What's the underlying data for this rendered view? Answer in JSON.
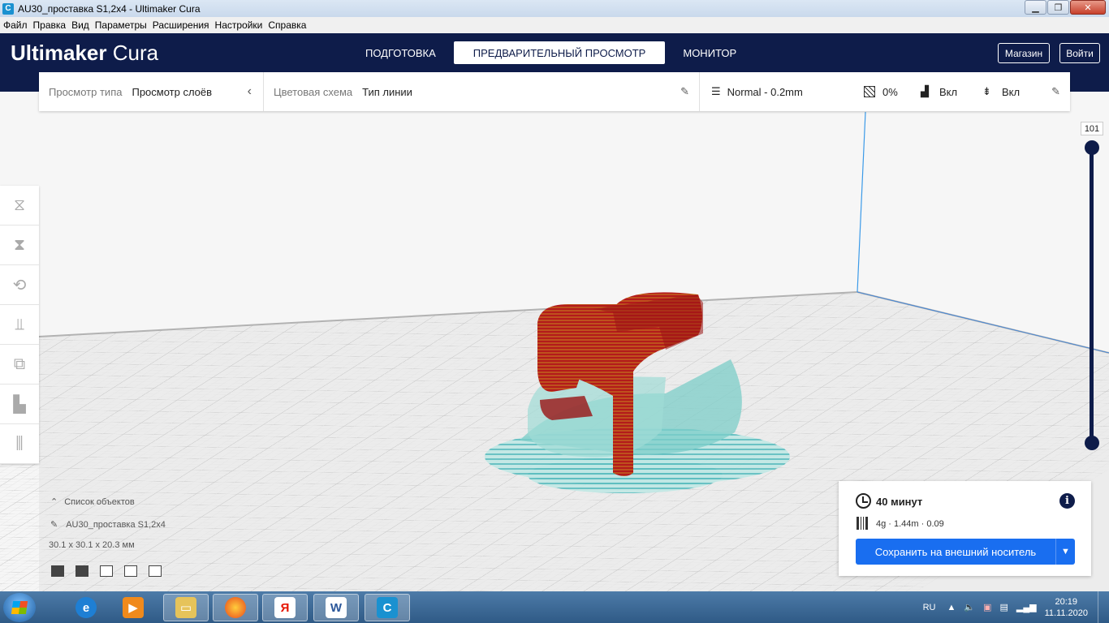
{
  "window": {
    "title": "AU30_проставка S1,2x4 - Ultimaker Cura",
    "app_icon": "cura-icon"
  },
  "menu": [
    "Файл",
    "Правка",
    "Вид",
    "Параметры",
    "Расширения",
    "Настройки",
    "Справка"
  ],
  "header": {
    "brand_bold": "Ultimaker",
    "brand_light": "Cura",
    "tabs": [
      {
        "label": "ПОДГОТОВКА",
        "active": false
      },
      {
        "label": "ПРЕДВАРИТЕЛЬНЫЙ ПРОСМОТР",
        "active": true
      },
      {
        "label": "МОНИТОР",
        "active": false
      }
    ],
    "marketplace": "Магазин",
    "signin": "Войти"
  },
  "settings_bar": {
    "view_type_label": "Просмотр типа",
    "view_type_value": "Просмотр слоёв",
    "color_scheme_label": "Цветовая схема",
    "color_scheme_value": "Тип линии",
    "profile": "Normal - 0.2mm",
    "infill": "0%",
    "support": "Вкл",
    "adhesion": "Вкл"
  },
  "toolbar": {
    "tools": [
      "move-icon",
      "scale-icon",
      "rotate-icon",
      "mirror-icon",
      "per-model-settings-icon",
      "support-blocker-icon",
      "custom-supports-icon"
    ]
  },
  "layer_slider": {
    "current_layer": "101",
    "max_layer": 101,
    "min_layer": 1
  },
  "object_list": {
    "header": "Список объектов",
    "object_name": "AU30_проставка S1,2x4",
    "dimensions": "30.1 x 30.1 x 20.3 мм",
    "view_buttons": [
      "3d-view-icon",
      "front-view-icon",
      "top-view-icon",
      "left-view-icon",
      "right-view-icon"
    ]
  },
  "print_panel": {
    "time": "40 минут",
    "material": "4g · 1.44m ·  0.09",
    "save_button": "Сохранить на внешний носитель"
  },
  "taskbar": {
    "apps": [
      "internet-explorer-icon",
      "media-player-icon",
      "file-explorer-icon",
      "firefox-icon",
      "yandex-browser-icon",
      "word-icon",
      "cura-icon"
    ],
    "language": "RU",
    "time": "20:19",
    "date": "11.11.2020"
  },
  "colors": {
    "header_bg": "#0e1c4a",
    "primary_button": "#196ef0",
    "model_wall": "#b31b1b",
    "model_skin": "#d8d021",
    "model_support": "#1aa3a8"
  }
}
